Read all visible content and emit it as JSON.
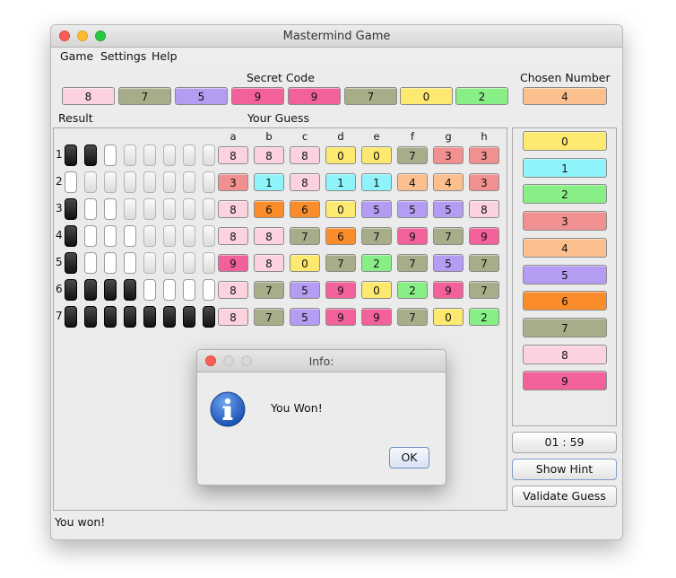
{
  "window": {
    "title": "Mastermind Game"
  },
  "menu": [
    "Game",
    "Settings",
    "Help"
  ],
  "labels": {
    "secret_code": "Secret Code",
    "chosen_number": "Chosen Number",
    "result": "Result",
    "your_guess": "Your Guess"
  },
  "colors": {
    "0": "#fde96f",
    "1": "#8ff3fb",
    "2": "#88ee86",
    "3": "#f09090",
    "4": "#fcc08e",
    "5": "#b49cf2",
    "6": "#fa8c2c",
    "7": "#a6ad88",
    "8": "#fbd2dd",
    "9": "#f3619a"
  },
  "secret_code": [
    "8",
    "7",
    "5",
    "9",
    "9",
    "7",
    "0",
    "2"
  ],
  "chosen_number": "4",
  "columns": [
    "a",
    "b",
    "c",
    "d",
    "e",
    "f",
    "g",
    "h"
  ],
  "rows": [
    {
      "num": "1",
      "pegs": [
        "black",
        "black",
        "white",
        "empty",
        "empty",
        "empty",
        "empty",
        "empty"
      ],
      "guess": [
        "8",
        "8",
        "8",
        "0",
        "0",
        "7",
        "3",
        "3"
      ]
    },
    {
      "num": "2",
      "pegs": [
        "white",
        "empty",
        "empty",
        "empty",
        "empty",
        "empty",
        "empty",
        "empty"
      ],
      "guess": [
        "3",
        "1",
        "8",
        "1",
        "1",
        "4",
        "4",
        "3"
      ]
    },
    {
      "num": "3",
      "pegs": [
        "black",
        "white",
        "white",
        "empty",
        "empty",
        "empty",
        "empty",
        "empty"
      ],
      "guess": [
        "8",
        "6",
        "6",
        "0",
        "5",
        "5",
        "5",
        "8"
      ]
    },
    {
      "num": "4",
      "pegs": [
        "black",
        "white",
        "white",
        "white",
        "empty",
        "empty",
        "empty",
        "empty"
      ],
      "guess": [
        "8",
        "8",
        "7",
        "6",
        "7",
        "9",
        "7",
        "9"
      ]
    },
    {
      "num": "5",
      "pegs": [
        "black",
        "white",
        "white",
        "white",
        "empty",
        "empty",
        "empty",
        "empty"
      ],
      "guess": [
        "9",
        "8",
        "0",
        "7",
        "2",
        "7",
        "5",
        "7"
      ]
    },
    {
      "num": "6",
      "pegs": [
        "black",
        "black",
        "black",
        "black",
        "white",
        "white",
        "white",
        "white"
      ],
      "guess": [
        "8",
        "7",
        "5",
        "9",
        "0",
        "2",
        "9",
        "7"
      ]
    },
    {
      "num": "7",
      "pegs": [
        "black",
        "black",
        "black",
        "black",
        "black",
        "black",
        "black",
        "black"
      ],
      "guess": [
        "8",
        "7",
        "5",
        "9",
        "9",
        "7",
        "0",
        "2"
      ]
    }
  ],
  "palette": [
    "0",
    "1",
    "2",
    "3",
    "4",
    "5",
    "6",
    "7",
    "8",
    "9"
  ],
  "timer": "01 : 59",
  "buttons": {
    "show_hint": "Show Hint",
    "validate_guess": "Validate Guess"
  },
  "status_text": "You won!",
  "dialog": {
    "title": "Info:",
    "message": "You Won!",
    "ok_label": "OK",
    "icon": "info-icon"
  }
}
